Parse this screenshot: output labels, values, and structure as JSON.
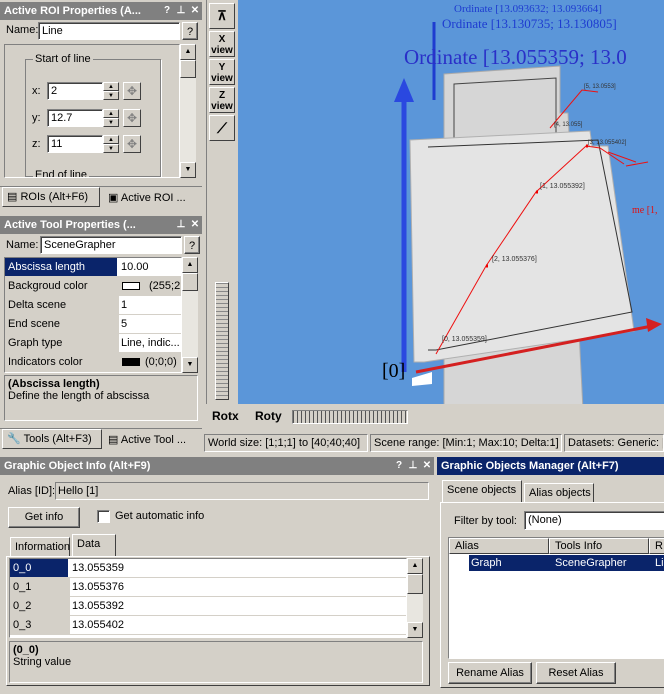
{
  "roi_panel": {
    "title": "Active ROI Properties (A...",
    "name_label": "Name:",
    "name_value": "Line",
    "help": "?",
    "start_group": "Start of line",
    "end_group": "End of line",
    "x_label": "x:",
    "x_value": "2",
    "y_label": "y:",
    "y_value": "12.7",
    "z_label": "z:",
    "z_value": "11",
    "tabs": [
      "ROIs (Alt+F6)",
      "Active ROI ..."
    ]
  },
  "tool_panel": {
    "title": "Active Tool Properties (...",
    "name_label": "Name:",
    "name_value": "SceneGrapher",
    "help": "?",
    "properties": [
      {
        "key": "Abscissa length",
        "value": "10.00"
      },
      {
        "key": "Backgroud color",
        "value": "(255;2"
      },
      {
        "key": "Delta scene",
        "value": "1"
      },
      {
        "key": "End scene",
        "value": "5"
      },
      {
        "key": "Graph type",
        "value": "Line, indic..."
      },
      {
        "key": "Indicators color",
        "value": "(0;0;0)"
      }
    ],
    "desc_title": "(Abscissa length)",
    "desc_text": "Define the length of abscissa",
    "tabs": [
      "Tools (Alt+F3)",
      "Active Tool ..."
    ]
  },
  "view_toolbar": {
    "x_view": "X\nview",
    "y_view": "Y\nview",
    "z_view": "Z\nview"
  },
  "scene": {
    "ordinate_top": "Ordinate [13.093632; 13.093664]",
    "ordinate_mid": "Ordinate [13.130735; 13.130805]",
    "ordinate_big": "Ordinate [13.055359; 13.0",
    "origin_label": "[0]",
    "point_labels": [
      "[0, 13.055359]",
      "[1, 13.055392]",
      "[2, 13.055376]",
      "[3, 13.055402]",
      "[4, 13.055]",
      "[5, 13.0553]"
    ],
    "side_label": "me [1,",
    "rot_x": "Rotx",
    "rot_y": "Roty"
  },
  "status": {
    "world": "World size: [1;1;1] to [40;40;40]",
    "range": "Scene range: [Min:1; Max:10; Delta:1]",
    "datasets": "Datasets: Generic: ["
  },
  "info_panel": {
    "title": "Graphic Object Info (Alt+F9)",
    "alias_label": "Alias [ID]:",
    "alias_value": "Hello [1]",
    "get_info": "Get info",
    "auto_info": "Get automatic info",
    "tabs": [
      "Information",
      "Data"
    ],
    "rows": [
      {
        "key": "0_0",
        "value": "13.055359"
      },
      {
        "key": "0_1",
        "value": "13.055376"
      },
      {
        "key": "0_2",
        "value": "13.055392"
      },
      {
        "key": "0_3",
        "value": "13.055402"
      }
    ],
    "desc_title": "(0_0)",
    "desc_text": "String value"
  },
  "manager_panel": {
    "title": "Graphic Objects Manager (Alt+F7)",
    "tabs": [
      "Scene objects",
      "Alias objects"
    ],
    "filter_label": "Filter by tool:",
    "filter_value": "(None)",
    "columns": [
      "Alias",
      "Tools Info",
      "R"
    ],
    "row": {
      "alias": "Graph",
      "tool": "SceneGrapher",
      "r": "Li"
    },
    "rename": "Rename Alias",
    "reset": "Reset Alias"
  },
  "colors": {
    "accent": "#0a246a",
    "viewport": "#5b96d9",
    "axis_red": "#d42020",
    "axis_blue": "#1e3cd0"
  }
}
